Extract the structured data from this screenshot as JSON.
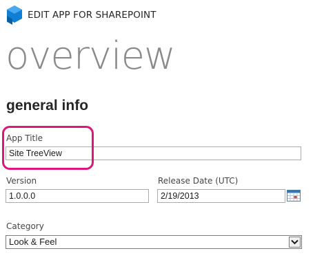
{
  "header": {
    "app_name": "EDIT APP FOR SHAREPOINT",
    "logo_icon": "sharepoint-logo-icon",
    "logo_color": "#0e7fd4"
  },
  "page": {
    "title": "overview"
  },
  "section": {
    "title": "general info"
  },
  "fields": {
    "app_title": {
      "label": "App Title",
      "value": "Site TreeView"
    },
    "version": {
      "label": "Version",
      "value": "1.0.0.0"
    },
    "release_date": {
      "label": "Release Date (UTC)",
      "value": "2/19/2013",
      "icon": "calendar-icon"
    },
    "category": {
      "label": "Category",
      "value": "Look & Feel",
      "icon": "chevron-down-icon"
    }
  },
  "colors": {
    "highlight": "#e0157b",
    "title_gray": "#8a8a8a"
  }
}
